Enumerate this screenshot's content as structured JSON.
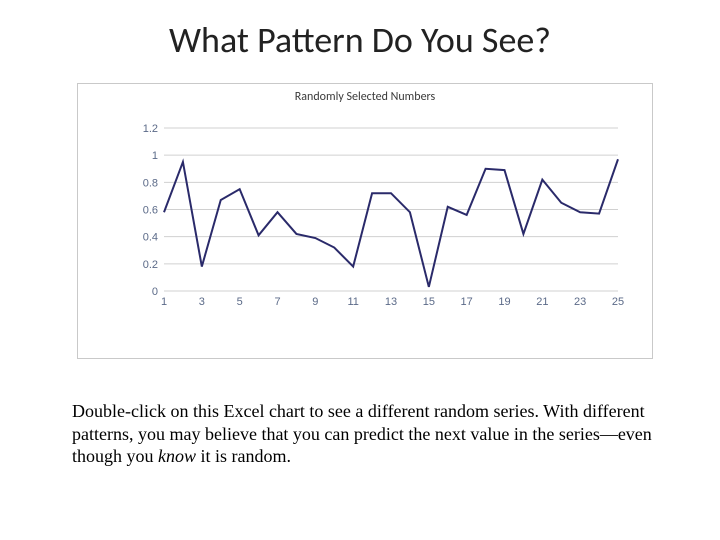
{
  "title": "What Pattern Do You See?",
  "chart_data": {
    "type": "line",
    "title": "Randomly Selected Numbers",
    "xlabel": "",
    "ylabel": "",
    "xlim": [
      1,
      25
    ],
    "ylim": [
      0,
      1.2
    ],
    "x_ticks": [
      1,
      3,
      5,
      7,
      9,
      11,
      13,
      15,
      17,
      19,
      21,
      23,
      25
    ],
    "y_ticks": [
      0,
      0.2,
      0.4,
      0.6,
      0.8,
      1,
      1.2
    ],
    "categories": [
      1,
      2,
      3,
      4,
      5,
      6,
      7,
      8,
      9,
      10,
      11,
      12,
      13,
      14,
      15,
      16,
      17,
      18,
      19,
      20,
      21,
      22,
      23,
      24,
      25
    ],
    "values": [
      0.58,
      0.95,
      0.18,
      0.67,
      0.75,
      0.41,
      0.58,
      0.42,
      0.39,
      0.32,
      0.18,
      0.72,
      0.72,
      0.58,
      0.03,
      0.62,
      0.56,
      0.9,
      0.89,
      0.42,
      0.82,
      0.65,
      0.58,
      0.57,
      0.97
    ]
  },
  "caption": {
    "pre": "Double-click on this Excel chart to see a different random series. With different patterns, you may believe that you can predict the next value in the series—even though you ",
    "em": "know",
    "post": " it is random."
  }
}
